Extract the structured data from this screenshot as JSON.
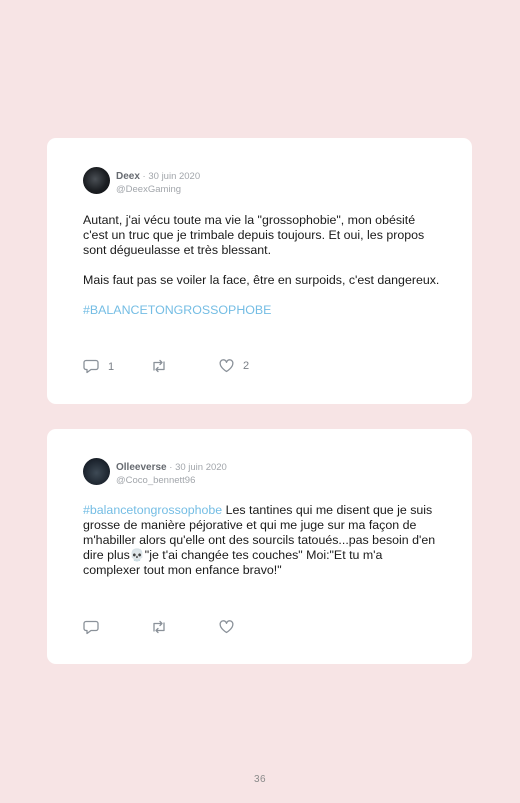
{
  "tweets": [
    {
      "name": "Deex",
      "date": "30 juin 2020",
      "handle": "@DeexGaming",
      "paragraph1": "Autant, j'ai vécu toute ma vie la \"grossophobie\", mon obésité c'est un truc que je trimbale depuis toujours. Et oui, les propos sont dégueulasse et très blessant.",
      "paragraph2": "Mais faut pas se voiler la face, être en surpoids, c'est dangereux.",
      "hashtag": "#BALANCETONGROSSOPHOBE",
      "reply_count": "1",
      "like_count": "2",
      "icons": {
        "reply": "comment-icon",
        "retweet": "retweet-icon",
        "like": "heart-icon"
      }
    },
    {
      "name": "Olleeverse",
      "date": "30 juin 2020",
      "handle": "@Coco_bennett96",
      "hashtag": "#balancetongrossophobe",
      "text_part1": " Les tantines qui me disent que je suis grosse de manière péjorative et qui me juge sur ma façon de m'habiller alors qu'elle ont des sourcils tatoués...pas besoin d'en dire plus",
      "emoji": "💀",
      "text_part2": "\"je t'ai changée tes couches\" Moi:\"Et tu m'a complexer tout mon enfance bravo!\"",
      "icons": {
        "reply": "comment-icon",
        "retweet": "retweet-icon",
        "like": "heart-icon"
      }
    }
  ],
  "page_number": "36",
  "colors": {
    "background": "#f7e4e5",
    "card": "#ffffff",
    "hashtag": "#74bde4"
  }
}
